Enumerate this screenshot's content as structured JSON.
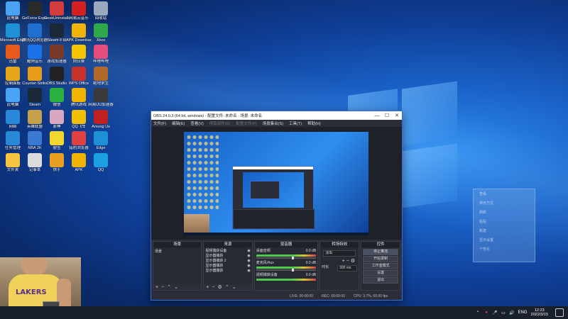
{
  "desktop": {
    "icons": [
      {
        "label": "此电脑",
        "color": "#4aa3f5"
      },
      {
        "label": "GeForce Experience",
        "color": "#2a2a2a"
      },
      {
        "label": "GeekUninstaller",
        "color": "#d43d3d"
      },
      {
        "label": "网易云音乐",
        "color": "#d42020"
      },
      {
        "label": "回收站",
        "color": "#9aa9bd"
      },
      {
        "label": "Microsoft Edge",
        "color": "#1e90d6"
      },
      {
        "label": "腾讯QQ浏览器",
        "color": "#1f6fd1"
      },
      {
        "label": "Steam平台",
        "color": "#1b2838"
      },
      {
        "label": "APK Downloader",
        "color": "#f0b400"
      },
      {
        "label": "Xbox",
        "color": "#2fa84a"
      },
      {
        "label": "迅雷",
        "color": "#e85a1b"
      },
      {
        "label": "酷狗音乐",
        "color": "#1a73e8"
      },
      {
        "label": "游戏加速器",
        "color": "#7a3a2a"
      },
      {
        "label": "向日葵",
        "color": "#f3c400"
      },
      {
        "label": "哔哩哔哩",
        "color": "#e44d7d"
      },
      {
        "label": "控制面板",
        "color": "#e5a71a"
      },
      {
        "label": "Counter-Strike",
        "color": "#e89a1a"
      },
      {
        "label": "OBS Studio",
        "color": "#222222"
      },
      {
        "label": "WPS Office",
        "color": "#c8322a"
      },
      {
        "label": "绝地求生",
        "color": "#b06a2a"
      },
      {
        "label": "此电脑",
        "color": "#4aa3f5"
      },
      {
        "label": "Steam",
        "color": "#1b2838"
      },
      {
        "label": "微信",
        "color": "#2ab03e"
      },
      {
        "label": "腾讯游戏",
        "color": "#f0b400"
      },
      {
        "label": "网易UU加速器",
        "color": "#3a3a3a"
      },
      {
        "label": "网络",
        "color": "#2a88d8"
      },
      {
        "label": "英雄联盟",
        "color": "#c5a24a"
      },
      {
        "label": "原神",
        "color": "#d9a8c0"
      },
      {
        "label": "QQ飞车",
        "color": "#f0c000"
      },
      {
        "label": "Among Us",
        "color": "#c02020"
      },
      {
        "label": "任务管理",
        "color": "#2a88d8"
      },
      {
        "label": "NBA 2K",
        "color": "#3a7ad0"
      },
      {
        "label": "便签",
        "color": "#f2d82a"
      },
      {
        "label": "猎豹浏览器",
        "color": "#e04040"
      },
      {
        "label": "Edge",
        "color": "#1e90d6"
      },
      {
        "label": "文件夹",
        "color": "#f5c542"
      },
      {
        "label": "记事本",
        "color": "#dcdcdc"
      },
      {
        "label": "快手",
        "color": "#e8a020"
      },
      {
        "label": "APK",
        "color": "#f0b400"
      },
      {
        "label": "QQ",
        "color": "#1a9fe0"
      }
    ]
  },
  "obs": {
    "title": "OBS 24.0.3 (64 bit, windows) - 配置文件: 未命名 - 场景: 未命名",
    "window_buttons": {
      "min": "—",
      "max": "☐",
      "close": "✕"
    },
    "menu": [
      "文件(F)",
      "编辑(E)",
      "查看(V)",
      "停靠部件(D)",
      "配置文件(P)",
      "场景集合(S)",
      "工具(T)",
      "帮助(H)"
    ],
    "docks": {
      "scenes": {
        "title": "场景",
        "items": [
          "场景"
        ]
      },
      "sources": {
        "title": "来源",
        "items": [
          "视频捕获设备",
          "显示器捕获",
          "显示器捕获 2",
          "显示器捕获",
          "显示器捕获"
        ]
      },
      "mixer": {
        "title": "混音器",
        "channels": [
          {
            "name": "桌面音频",
            "db": "0.0 dB"
          },
          {
            "name": "麦克风/Aux",
            "db": "0.0 dB"
          },
          {
            "name": "视频捕获设备",
            "db": "0.0 dB"
          }
        ]
      },
      "transitions": {
        "title": "转场特效",
        "type": "淡出",
        "duration_label": "时长",
        "duration": "300 ms"
      },
      "controls": {
        "title": "控件",
        "buttons": [
          "停止推流",
          "开始录制",
          "工作室模式",
          "设置",
          "退出"
        ]
      }
    },
    "status": {
      "live": "LIVE: 00:00:00",
      "rec": "REC: 00:00:00",
      "cpu": "CPU: 3.7%, 60.00 fps"
    }
  },
  "popup_ghost": {
    "items": [
      "查看",
      "排序方式",
      "刷新",
      "粘贴",
      "新建",
      "显示设置",
      "个性化"
    ]
  },
  "webcam": {
    "shirt_text": "LAKERS"
  },
  "taskbar": {
    "tray_lang": "ENG",
    "time": "12:23",
    "date": "2022/3/15",
    "accent": "#1a1f2c"
  }
}
